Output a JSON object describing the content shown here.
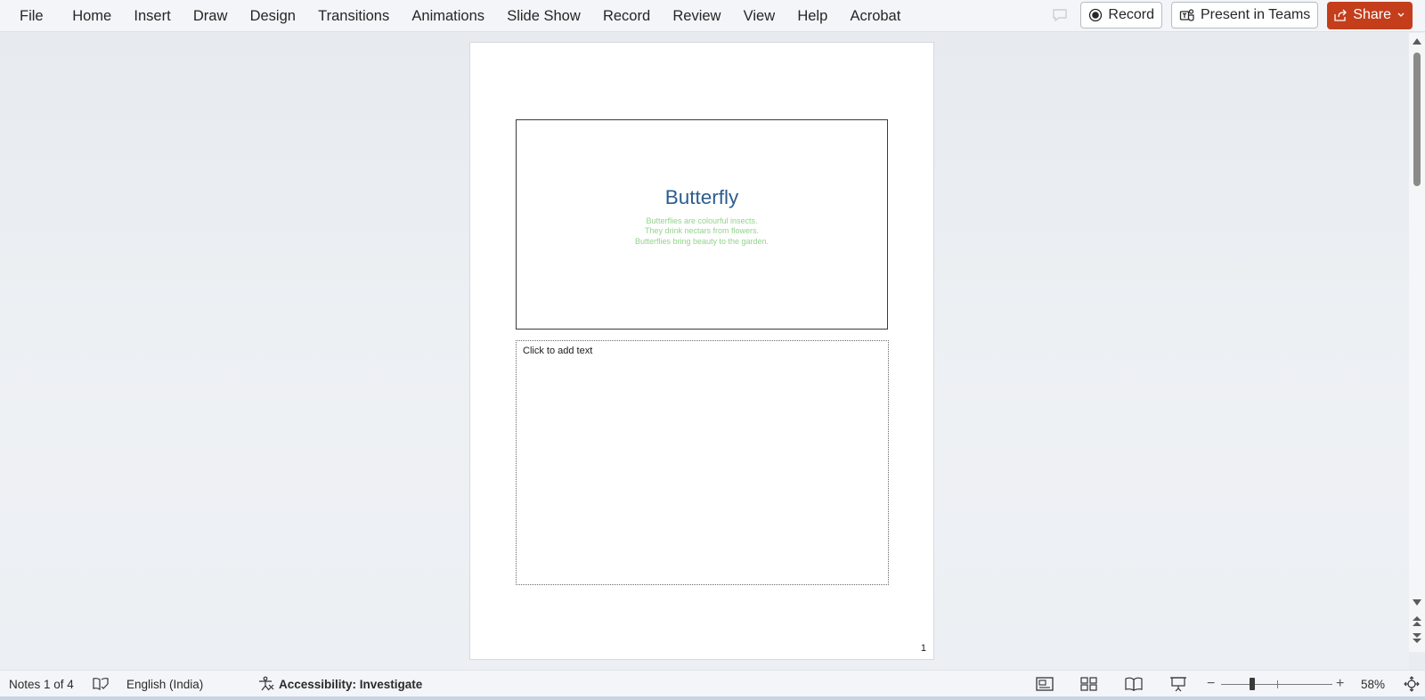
{
  "ribbon": {
    "tabs": [
      "File",
      "Home",
      "Insert",
      "Draw",
      "Design",
      "Transitions",
      "Animations",
      "Slide Show",
      "Record",
      "Review",
      "View",
      "Help",
      "Acrobat"
    ],
    "record_label": "Record",
    "present_teams_label": "Present in Teams",
    "share_label": "Share"
  },
  "slide": {
    "title": "Butterfly",
    "lines": [
      "Butterflies are colourful insects.",
      "They drink nectars from flowers.",
      "Butterflies bring beauty to the garden."
    ],
    "title_color": "#2b5d8e",
    "body_color": "#92d38c"
  },
  "notes": {
    "placeholder": "Click to add text",
    "page_number": "1"
  },
  "status": {
    "notes_position": "Notes 1 of 4",
    "language": "English (India)",
    "accessibility": "Accessibility: Investigate",
    "zoom": "58%"
  },
  "colors": {
    "share_accent": "#c43e1c"
  }
}
